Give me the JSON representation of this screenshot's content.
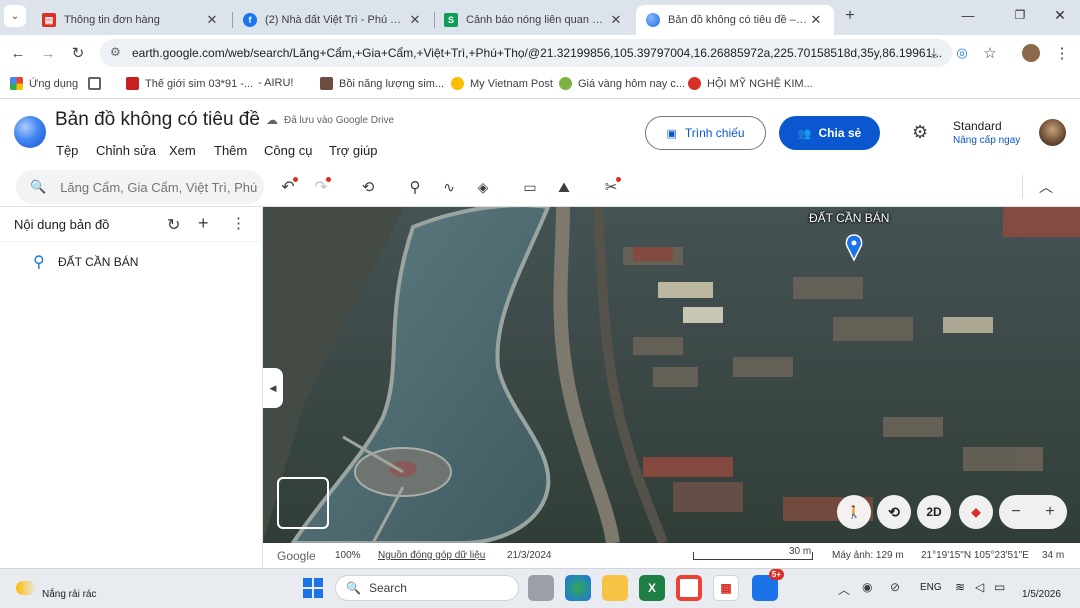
{
  "browser": {
    "tabs": [
      {
        "title": "Thông tin đơn hàng",
        "active": false,
        "icon": "red-doc-icon"
      },
      {
        "title": "(2) Nhà đất Việt Trì - Phú Thọ | F",
        "active": false,
        "icon": "facebook-icon"
      },
      {
        "title": "Cảnh báo nóng liên quan vụ thi",
        "active": false,
        "icon": "s-icon"
      },
      {
        "title": "Bản đồ không có tiêu đề – Goo",
        "active": true,
        "icon": "google-earth-icon"
      }
    ],
    "new_tab": "+",
    "url": "earth.google.com/web/search/Lăng+Cẩm,+Gia+Cẩm,+Việt+Trì,+Phú+Thọ/@21.32199856,105.39797004,16.26885972a,225.70158518d,35y,86.19961..."
  },
  "bookmarks": [
    {
      "label": "Ứng dụng"
    },
    {
      "label": ""
    },
    {
      "label": "Thế giới sim 03*91 -..."
    },
    {
      "label": "- AIRU!"
    },
    {
      "label": "Bồi năng lượng sim..."
    },
    {
      "label": "My Vietnam Post"
    },
    {
      "label": "Giá vàng hôm nay c..."
    },
    {
      "label": "HỘI MỸ NGHỆ KIM..."
    }
  ],
  "app": {
    "title": "Bản đồ không có tiêu đề",
    "save_status": "Đã lưu vào Google Drive",
    "menu": [
      "Tệp",
      "Chỉnh sửa",
      "Xem",
      "Thêm",
      "Công cụ",
      "Trợ giúp"
    ],
    "present_button": "Trình chiếu",
    "share_button": "Chia sẻ",
    "plan_name": "Standard",
    "upgrade_link": "Nâng cấp ngay",
    "search_placeholder": "Lăng Cẩm, Gia Cẩm, Việt Trì, Phú"
  },
  "side_panel": {
    "heading": "Nội dung bản đồ",
    "items": [
      {
        "label": "ĐẤT CẦN BÁN"
      }
    ]
  },
  "map": {
    "placemark_label": "ĐẤT CẦN BÁN",
    "view_2d_button": "2D",
    "zoom_out": "−",
    "zoom_in": "+"
  },
  "status_bar": {
    "brand": "Google",
    "zoom": "100%",
    "data_source": "Nguồn đóng góp dữ liệu",
    "date": "21/3/2024",
    "scale": "30 m",
    "camera": "Máy ảnh: 129 m",
    "coordinates": "21°19'15\"N 105°23'51\"E",
    "elevation": "34 m"
  },
  "taskbar": {
    "weather": "Nắng rải rác",
    "search": "Search",
    "language": "ENG",
    "date": "1/5/2026",
    "notification_badge": "5+"
  },
  "colors": {
    "accent": "#0b57d0",
    "tab_strip": "#dde3ea",
    "map_water": "#4e6b73"
  }
}
